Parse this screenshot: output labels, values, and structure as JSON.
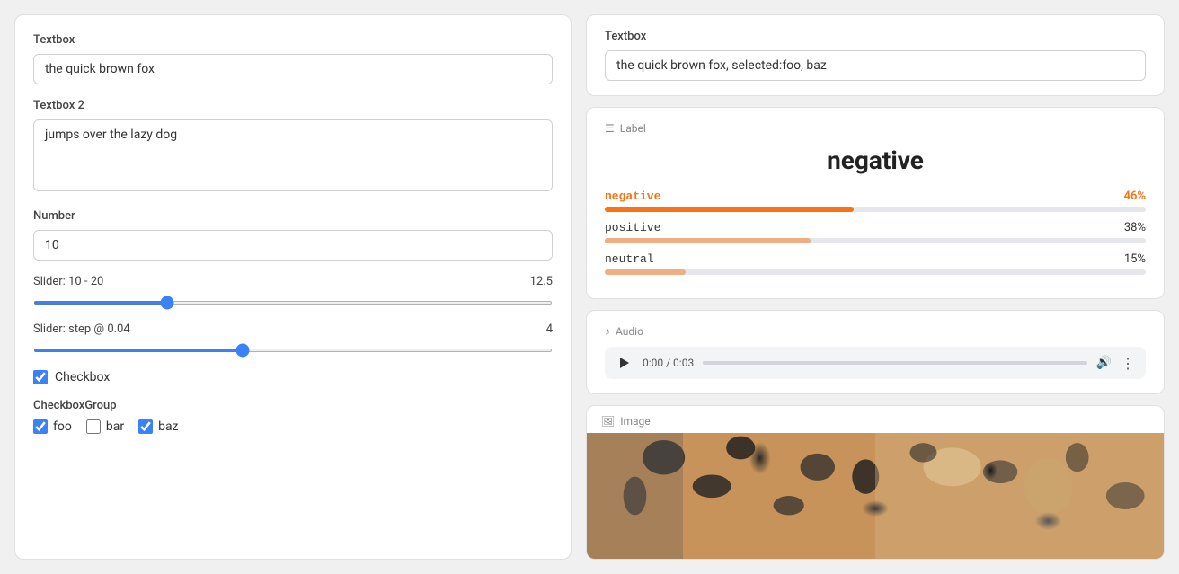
{
  "left": {
    "textbox1_label": "Textbox",
    "textbox1_value": "the quick brown fox",
    "textbox1_placeholder": "",
    "textbox2_label": "Textbox 2",
    "textbox2_value": "jumps over the lazy dog",
    "textbox2_placeholder": "",
    "number_label": "Number",
    "number_value": "10",
    "slider1_label": "Slider: 10 - 20",
    "slider1_value": "12.5",
    "slider1_min": 10,
    "slider1_max": 20,
    "slider1_current": 12.5,
    "slider2_label": "Slider: step @ 0.04",
    "slider2_value": "4",
    "slider2_min": 0,
    "slider2_max": 10,
    "slider2_current": 4,
    "checkbox_label": "Checkbox",
    "checkbox_checked": true,
    "checkbox_group_label": "CheckboxGroup",
    "checkbox_items": [
      {
        "id": "foo",
        "label": "foo",
        "checked": true
      },
      {
        "id": "bar",
        "label": "bar",
        "checked": false
      },
      {
        "id": "baz",
        "label": "baz",
        "checked": true
      }
    ]
  },
  "right": {
    "textbox_label": "Textbox",
    "textbox_value": "the quick brown fox, selected:foo, baz",
    "label_section_title": "Label",
    "predicted_label": "negative",
    "bars": [
      {
        "name": "negative",
        "percent": 46,
        "active": true
      },
      {
        "name": "positive",
        "percent": 38,
        "active": false
      },
      {
        "name": "neutral",
        "percent": 15,
        "active": false
      }
    ],
    "audio_section_title": "Audio",
    "audio_time": "0:00 / 0:03",
    "image_section_title": "Image"
  }
}
